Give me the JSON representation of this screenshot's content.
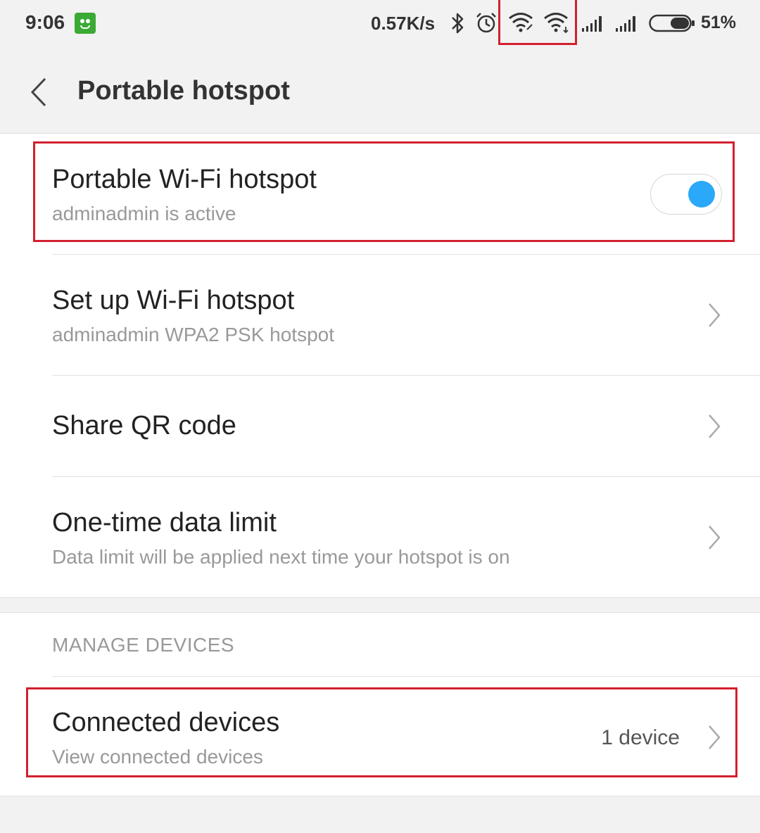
{
  "status_bar": {
    "time": "9:06",
    "network_speed": "0.57K/s",
    "battery_percent": "51%",
    "icons": [
      "app-notification-icon",
      "bluetooth-icon",
      "alarm-icon",
      "wifi-linked-icon",
      "wifi-hotspot-icon",
      "signal-sim1-icon",
      "signal-sim2-icon",
      "battery-icon"
    ]
  },
  "header": {
    "title": "Portable hotspot"
  },
  "settings": {
    "hotspot_toggle": {
      "title": "Portable Wi-Fi hotspot",
      "subtitle": "adminadmin is active",
      "enabled": true
    },
    "setup": {
      "title": "Set up Wi-Fi hotspot",
      "subtitle": "adminadmin WPA2 PSK hotspot"
    },
    "share_qr": {
      "title": "Share QR code"
    },
    "data_limit": {
      "title": "One-time data limit",
      "subtitle": "Data limit will be applied next time your hotspot is on"
    }
  },
  "manage_devices": {
    "section_label": "MANAGE DEVICES",
    "connected": {
      "title": "Connected devices",
      "subtitle": "View connected devices",
      "value": "1 device"
    }
  },
  "colors": {
    "accent": "#2aa8f9",
    "highlight": "#d3202f"
  }
}
